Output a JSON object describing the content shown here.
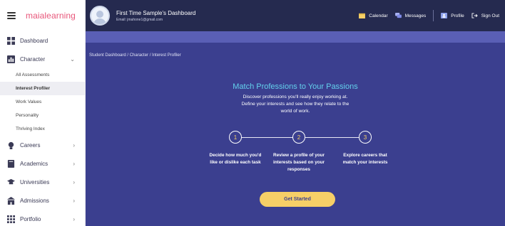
{
  "brand": {
    "name": "maialearning"
  },
  "header": {
    "user_name": "First Time Sample's Dashboard",
    "user_email": "Email: jmahone1@gmail.com",
    "nav": [
      {
        "label": "Calendar",
        "icon": "calendar-icon"
      },
      {
        "label": "Messages",
        "icon": "messages-icon"
      },
      {
        "label": "Profile",
        "icon": "profile-icon"
      },
      {
        "label": "Sign Out",
        "icon": "sign-out-icon"
      }
    ]
  },
  "sidebar": {
    "items": [
      {
        "label": "Dashboard",
        "icon": "dashboard-icon"
      },
      {
        "label": "Character",
        "icon": "character-icon",
        "chevron": "⌄"
      },
      {
        "label": "Careers",
        "icon": "careers-icon",
        "chevron": "›"
      },
      {
        "label": "Academics",
        "icon": "academics-icon",
        "chevron": "›"
      },
      {
        "label": "Universities",
        "icon": "universities-icon",
        "chevron": "›"
      },
      {
        "label": "Admissions",
        "icon": "admissions-icon",
        "chevron": "›"
      },
      {
        "label": "Portfolio",
        "icon": "portfolio-icon",
        "chevron": "›"
      }
    ],
    "subitems": [
      {
        "label": "All Assessments",
        "active": false
      },
      {
        "label": "Interest Profiler",
        "active": true
      },
      {
        "label": "Work Values",
        "active": false
      },
      {
        "label": "Personality",
        "active": false
      },
      {
        "label": "Thriving Index",
        "active": false
      }
    ]
  },
  "breadcrumb": "Student Dashboard / Character / Interest Profiler",
  "main": {
    "title": "Match Professions to Your Passions",
    "description": "Discover professions you'll really enjoy working at. Define your interests and see how they relate to the world of work.",
    "steps": [
      {
        "number": "1",
        "text": "Decide how much you'd like or dislike each task"
      },
      {
        "number": "2",
        "text": "Review a profile of your interests based on your responses"
      },
      {
        "number": "3",
        "text": "Explore careers that match your interests"
      }
    ],
    "cta_label": "Get Started"
  },
  "colors": {
    "accent": "#63d0ec",
    "button": "#f6cf67",
    "background": "#3b3f8f",
    "topbar": "#252a4f",
    "brand": "#e8567a"
  }
}
